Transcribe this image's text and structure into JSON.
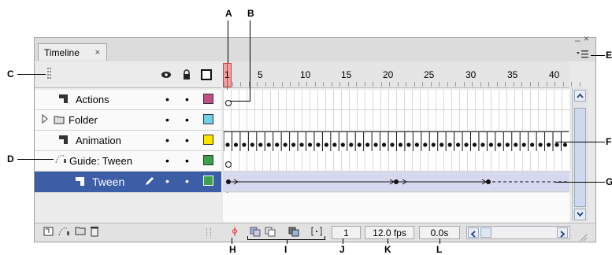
{
  "callouts": {
    "A": "A",
    "B": "B",
    "C": "C",
    "D": "D",
    "E": "E",
    "F": "F",
    "G": "G",
    "H": "H",
    "I": "I",
    "J": "J",
    "K": "K",
    "L": "L"
  },
  "panel": {
    "tab_label": "Timeline",
    "tab_close": "×",
    "minimize": "–",
    "close": "×",
    "menu_icon": "panel-menu-icon"
  },
  "header": {
    "eye_icon": "eye-icon",
    "lock_icon": "lock-icon",
    "outline_icon": "outline-icon",
    "frame_numbers": [
      "1",
      "5",
      "10",
      "15",
      "20",
      "25",
      "30",
      "35",
      "40"
    ]
  },
  "layers": [
    {
      "name": "Actions",
      "icon": "layer-icon",
      "color": "#c04f8a"
    },
    {
      "name": "Folder",
      "icon": "folder-icon",
      "color": "#6fd0e8"
    },
    {
      "name": "Animation",
      "icon": "layer-icon",
      "color": "#ffe400"
    },
    {
      "name": "Guide: Tween",
      "icon": "guide-icon",
      "color": "#3f9f4a"
    },
    {
      "name": "Tween",
      "icon": "layer-icon",
      "color": "#3f9f4a",
      "selected": true
    }
  ],
  "status": {
    "current_frame": "1",
    "frame_rate": "12.0 fps",
    "elapsed_time": "0.0s"
  },
  "colors": {
    "playhead": "#e03030",
    "selection": "#3c5ea6"
  }
}
